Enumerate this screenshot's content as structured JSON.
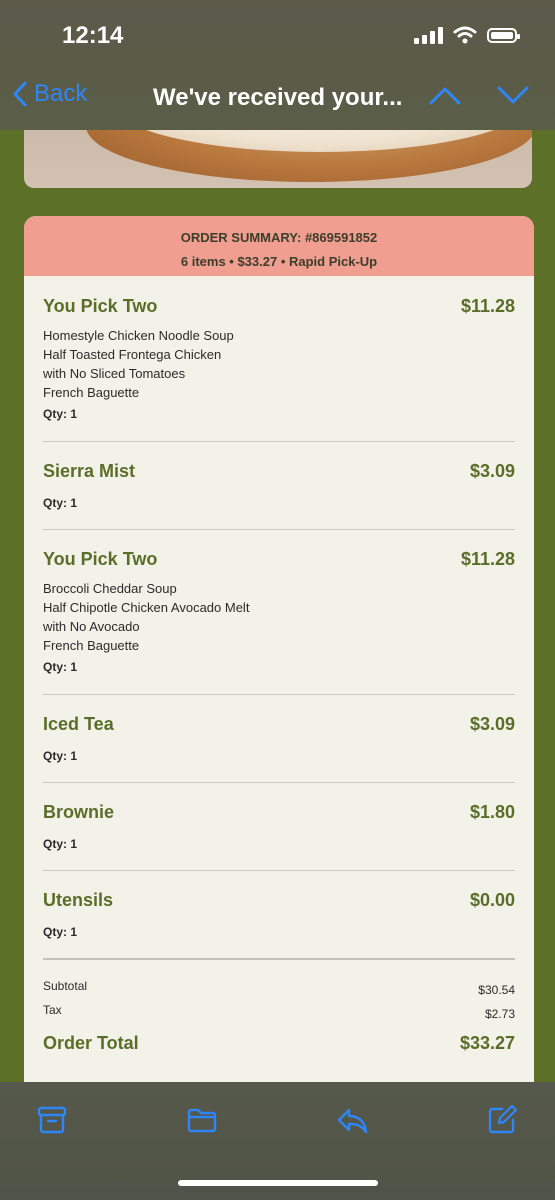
{
  "status_bar": {
    "time": "12:14"
  },
  "nav": {
    "back_label": "Back",
    "title": "We've received your..."
  },
  "order": {
    "summary_title": "ORDER SUMMARY: #869591852",
    "summary_subtitle": "6 items • $33.27 • Rapid Pick-Up",
    "items": [
      {
        "name": "You Pick Two",
        "price": "$11.28",
        "details": [
          "Homestyle Chicken Noodle Soup",
          "Half Toasted Frontega Chicken",
          "with No Sliced Tomatoes",
          "French Baguette"
        ],
        "qty": "Qty: 1"
      },
      {
        "name": "Sierra Mist",
        "price": "$3.09",
        "details": [],
        "qty": "Qty: 1"
      },
      {
        "name": "You Pick Two",
        "price": "$11.28",
        "details": [
          "Broccoli Cheddar Soup",
          "Half Chipotle Chicken Avocado Melt",
          "with No Avocado",
          "French Baguette"
        ],
        "qty": "Qty: 1"
      },
      {
        "name": "Iced Tea",
        "price": "$3.09",
        "details": [],
        "qty": "Qty: 1"
      },
      {
        "name": "Brownie",
        "price": "$1.80",
        "details": [],
        "qty": "Qty: 1"
      },
      {
        "name": "Utensils",
        "price": "$0.00",
        "details": [],
        "qty": "Qty: 1"
      }
    ],
    "subtotal_label": "Subtotal",
    "subtotal_value": "$30.54",
    "tax_label": "Tax",
    "tax_value": "$2.73",
    "total_label": "Order Total",
    "total_value": "$33.27"
  },
  "toolbar": {
    "icons": [
      "archive-icon",
      "folder-icon",
      "reply-icon",
      "compose-icon"
    ]
  },
  "colors": {
    "background_green": "#5c7028",
    "header_salmon": "#ef9e8f",
    "accent_blue": "#2f86f6",
    "item_green": "#5a6e2a"
  }
}
